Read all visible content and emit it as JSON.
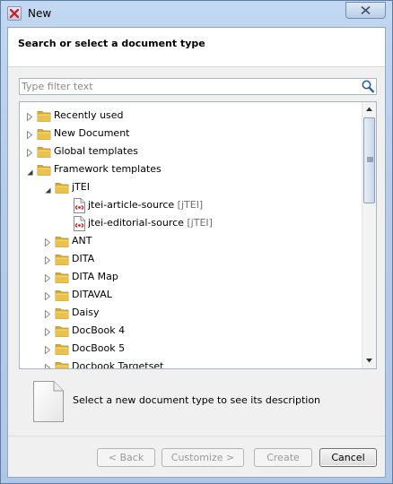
{
  "window": {
    "title": "New",
    "close_icon": "close-icon"
  },
  "header": {
    "title": "Search or select a document type"
  },
  "filter": {
    "value": "",
    "placeholder": "Type filter text",
    "icon": "search-icon"
  },
  "tree": {
    "items": [
      {
        "label": "Recently used",
        "suffix": "",
        "expanded": false,
        "type": "folder",
        "level": 0
      },
      {
        "label": "New Document",
        "suffix": "",
        "expanded": false,
        "type": "folder",
        "level": 0
      },
      {
        "label": "Global templates",
        "suffix": "",
        "expanded": false,
        "type": "folder",
        "level": 0
      },
      {
        "label": "Framework templates",
        "suffix": "",
        "expanded": true,
        "type": "folder",
        "level": 0
      },
      {
        "label": "jTEI",
        "suffix": "",
        "expanded": true,
        "type": "folder",
        "level": 1
      },
      {
        "label": "jtei-article-source",
        "suffix": "[jTEI]",
        "type": "document",
        "level": 2
      },
      {
        "label": "jtei-editorial-source",
        "suffix": "[jTEI]",
        "type": "document",
        "level": 2
      },
      {
        "label": "ANT",
        "suffix": "",
        "expanded": false,
        "type": "folder",
        "level": 1
      },
      {
        "label": "DITA",
        "suffix": "",
        "expanded": false,
        "type": "folder",
        "level": 1
      },
      {
        "label": "DITA Map",
        "suffix": "",
        "expanded": false,
        "type": "folder",
        "level": 1
      },
      {
        "label": "DITAVAL",
        "suffix": "",
        "expanded": false,
        "type": "folder",
        "level": 1
      },
      {
        "label": "Daisy",
        "suffix": "",
        "expanded": false,
        "type": "folder",
        "level": 1
      },
      {
        "label": "DocBook 4",
        "suffix": "",
        "expanded": false,
        "type": "folder",
        "level": 1
      },
      {
        "label": "DocBook 5",
        "suffix": "",
        "expanded": false,
        "type": "folder",
        "level": 1
      },
      {
        "label": "Docbook Targetset",
        "suffix": "",
        "expanded": false,
        "type": "folder",
        "level": 1
      }
    ]
  },
  "description": {
    "text": "Select a new document type to see its description",
    "icon": "blank-document-icon"
  },
  "buttons": {
    "back": {
      "label": "< Back",
      "enabled": false
    },
    "customize": {
      "label": "Customize >",
      "enabled": false
    },
    "create": {
      "label": "Create",
      "enabled": false
    },
    "cancel": {
      "label": "Cancel",
      "enabled": true
    }
  },
  "colors": {
    "folder": "#e8c24a",
    "doc_accent": "#d02020",
    "tree_line": "#aab4c4"
  }
}
